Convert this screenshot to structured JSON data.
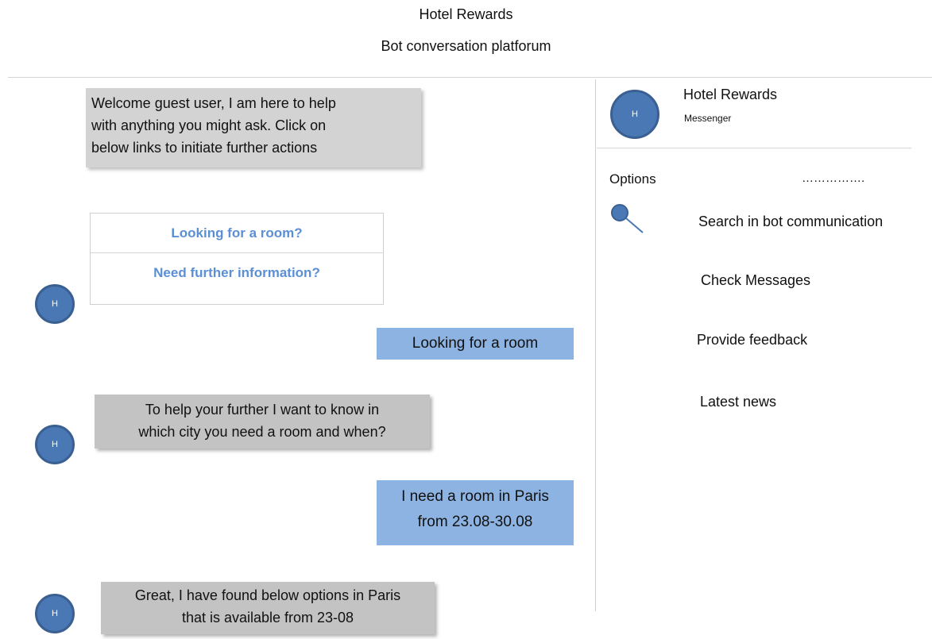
{
  "header": {
    "title": "Hotel Rewards",
    "subtitle": "Bot conversation platforum"
  },
  "chat": {
    "bot_avatar_initial": "H",
    "welcome_lines": [
      "Welcome guest user, I am here to help",
      "with anything you might ask. Click on",
      "below links to initiate further actions"
    ],
    "quick_links": [
      "Looking for a room?",
      "Need further information?"
    ],
    "user_msg_1": "Looking for a room",
    "bot_msg_2_lines": [
      "To help your further I want to know in",
      "which city you need a room and when?"
    ],
    "user_msg_2_lines": [
      "I need a room in Paris",
      "from 23.08-30.08"
    ],
    "bot_msg_3_lines": [
      "Great, I have found below options in Paris",
      "that is available from 23-08"
    ]
  },
  "sidebar": {
    "avatar_initial": "H",
    "title": "Hotel Rewards",
    "subtitle": "Messenger",
    "options_label": "Options",
    "options_dots": "…………….",
    "items": [
      {
        "label": "Search in bot communication",
        "icon": "search-icon"
      },
      {
        "label": "Check Messages"
      },
      {
        "label": "Provide feedback"
      },
      {
        "label": "Latest news"
      }
    ]
  }
}
